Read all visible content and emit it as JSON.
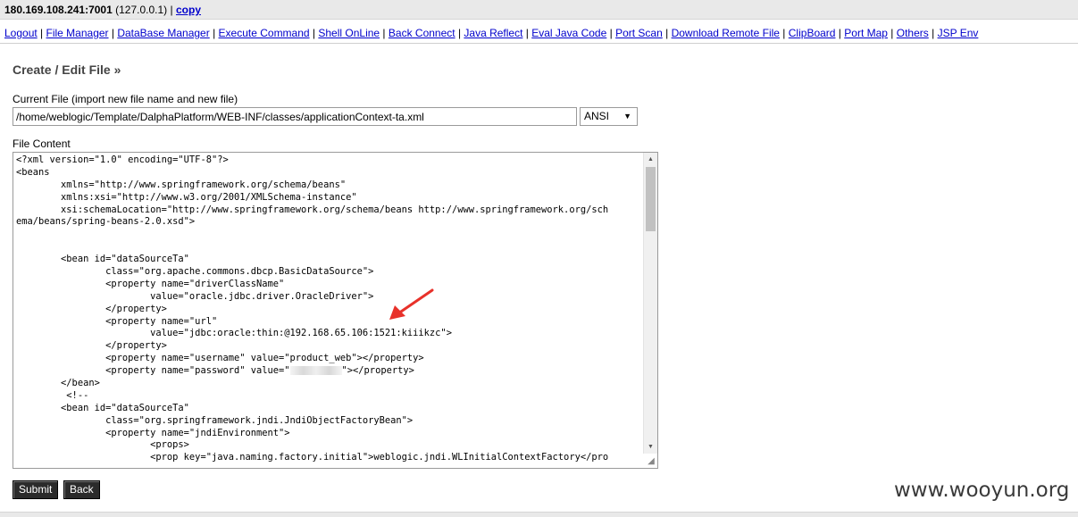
{
  "topbar": {
    "host": "180.169.108.241:7001",
    "local": "(127.0.0.1)",
    "sep": "|",
    "copy_label": "copy"
  },
  "menu": [
    "Logout",
    "File Manager",
    "DataBase Manager",
    "Execute Command",
    "Shell OnLine",
    "Back Connect",
    "Java Reflect",
    "Eval Java Code",
    "Port Scan",
    "Download Remote File",
    "ClipBoard",
    "Port Map",
    "Others",
    "JSP Env"
  ],
  "page": {
    "title": "Create / Edit File »",
    "current_file_label": "Current File (import new file name and new file)",
    "current_file_value": "/home/weblogic/Template/DalphaPlatform/WEB-INF/classes/applicationContext-ta.xml",
    "encoding": "ANSI",
    "content_label": "File Content"
  },
  "editor": {
    "lines_before_password": [
      "<?xml version=\"1.0\" encoding=\"UTF-8\"?>",
      "<beans",
      "        xmlns=\"http://www.springframework.org/schema/beans\"",
      "        xmlns:xsi=\"http://www.w3.org/2001/XMLSchema-instance\"",
      "        xsi:schemaLocation=\"http://www.springframework.org/schema/beans http://www.springframework.org/sch",
      "ema/beans/spring-beans-2.0.xsd\">",
      "",
      "",
      "        <bean id=\"dataSourceTa\"",
      "                class=\"org.apache.commons.dbcp.BasicDataSource\">",
      "                <property name=\"driverClassName\"",
      "                        value=\"oracle.jdbc.driver.OracleDriver\">",
      "                </property>",
      "                <property name=\"url\"",
      "                        value=\"jdbc:oracle:thin:@192.168.65.106:1521:kiiikzc\">",
      "                </property>",
      "                <property name=\"username\" value=\"product_web\"></property>"
    ],
    "password_prefix": "                <property name=\"password\" value=\"",
    "password_suffix": "\"></property>",
    "lines_after_password": [
      "        </bean>",
      "         <!--",
      "        <bean id=\"dataSourceTa\"",
      "                class=\"org.springframework.jndi.JndiObjectFactoryBean\">",
      "                <property name=\"jndiEnvironment\">",
      "                        <props>",
      "                        <prop key=\"java.naming.factory.initial\">weblogic.jndi.WLInitialContextFactory</pro"
    ]
  },
  "buttons": {
    "submit": "Submit",
    "back": "Back"
  },
  "watermark": "www.wooyun.org",
  "colors": {
    "link": "#0000cc",
    "annotation_arrow": "#e8312a",
    "button_bg": "#2b2b2b"
  }
}
